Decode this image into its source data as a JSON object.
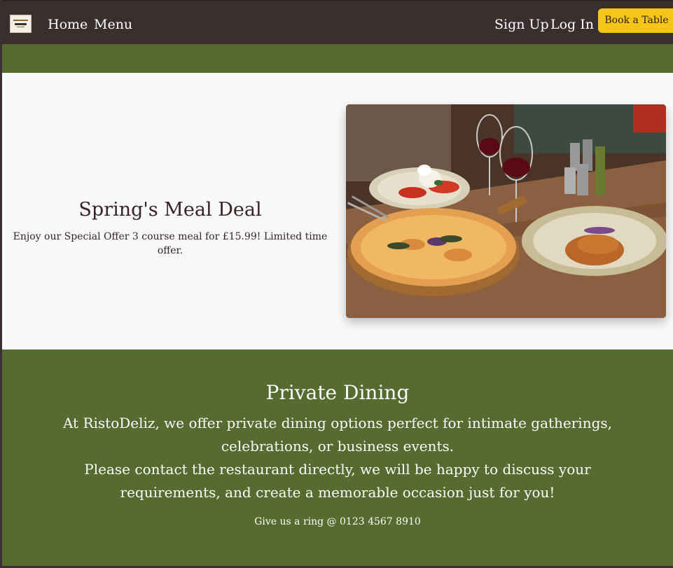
{
  "nav": {
    "home": "Home",
    "menu": "Menu",
    "sign_up": "Sign Up",
    "log_in": "Log In",
    "book_table": "Book a Table"
  },
  "hero": {
    "title": "Spring's Meal Deal",
    "text": "Enjoy our Special Offer 3 course meal for £15.99! Limited time offer.",
    "image_name": "pizza-and-pasta-photo"
  },
  "dining": {
    "title": "Private Dining",
    "paragraph1": "At RistoDeliz, we offer private dining options perfect for intimate gatherings, celebrations, or business events.",
    "paragraph2": "Please contact the restaurant directly, we will be happy to discuss your requirements, and create a memorable occasion just for you!",
    "phone": "Give us a ring @ 0123 4567 8910"
  },
  "colors": {
    "navbar": "#3a2f2f",
    "green": "#556b2f",
    "hero_bg": "#f8f9fa",
    "button": "#f5c518",
    "heading_text": "#3a2323"
  }
}
